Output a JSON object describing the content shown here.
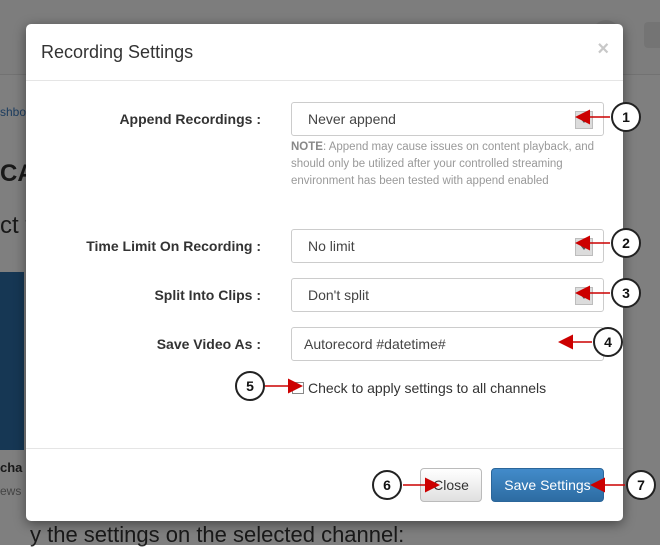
{
  "background": {
    "breadcrumb": "shbo",
    "heading": "CA",
    "subheading": "ct t",
    "thumb_label": "cha",
    "thumb_sub": "ews",
    "footer_text": "y the settings on the selected channel:"
  },
  "modal": {
    "title": "Recording Settings",
    "close_glyph": "×",
    "fields": {
      "append": {
        "label": "Append Recordings :",
        "value": "Never append"
      },
      "note_prefix": "NOTE",
      "note_text": ": Append may cause issues on content playback, and should only be utilized after your controlled streaming environment has been tested with append enabled",
      "time_limit": {
        "label": "Time Limit On Recording :",
        "value": "No limit"
      },
      "split": {
        "label": "Split Into Clips :",
        "value": "Don't split"
      },
      "save_as": {
        "label": "Save Video As :",
        "value": "Autorecord #datetime#"
      },
      "apply_all": {
        "label": "Check to apply settings to all channels",
        "checked": false
      }
    },
    "buttons": {
      "close": "Close",
      "save": "Save Settings"
    }
  },
  "callouts": [
    "1",
    "2",
    "3",
    "4",
    "5",
    "6",
    "7"
  ],
  "colors": {
    "primary": "#337ab7",
    "arrow": "#cc0000"
  }
}
